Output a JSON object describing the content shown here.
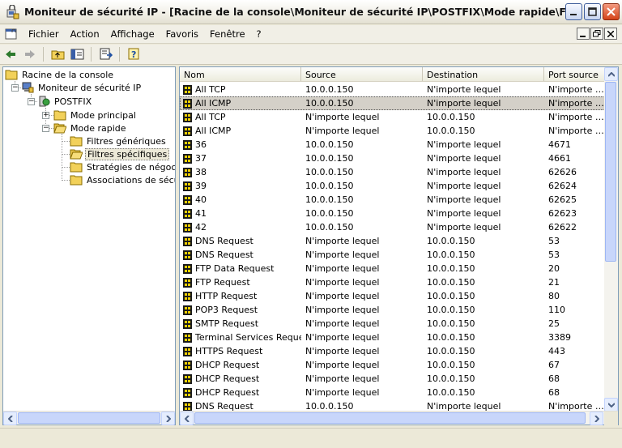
{
  "window": {
    "title": "Moniteur de sécurité IP - [Racine de la console\\Moniteur de sécurité IP\\POSTFIX\\Mode rapide\\Filtres spé..."
  },
  "menu": {
    "items": [
      {
        "label": "Fichier"
      },
      {
        "label": "Action"
      },
      {
        "label": "Affichage"
      },
      {
        "label": "Favoris"
      },
      {
        "label": "Fenêtre"
      },
      {
        "label": "?"
      }
    ]
  },
  "tree": {
    "nodes": [
      {
        "label": "Racine de la console",
        "icon": "folder-icon"
      },
      {
        "label": "Moniteur de sécurité IP",
        "icon": "computer-network-icon"
      },
      {
        "label": "POSTFIX",
        "icon": "server-icon"
      },
      {
        "label": "Mode principal",
        "icon": "folder-icon"
      },
      {
        "label": "Mode rapide",
        "icon": "folder-open-icon"
      },
      {
        "label": "Filtres génériques",
        "icon": "folder-icon"
      },
      {
        "label": "Filtres spécifiques",
        "icon": "folder-open-icon"
      },
      {
        "label": "Stratégies de négociatio",
        "icon": "folder-icon"
      },
      {
        "label": "Associations de sécurité",
        "icon": "folder-icon"
      }
    ]
  },
  "list": {
    "columns": [
      "Nom",
      "Source",
      "Destination",
      "Port source"
    ],
    "rows": [
      [
        "All TCP",
        "10.0.0.150",
        "N'importe lequel",
        "N'importe le..."
      ],
      [
        "All ICMP",
        "10.0.0.150",
        "N'importe lequel",
        "N'importe le..."
      ],
      [
        "All TCP",
        "N'importe lequel",
        "10.0.0.150",
        "N'importe le..."
      ],
      [
        "All ICMP",
        "N'importe lequel",
        "10.0.0.150",
        "N'importe le..."
      ],
      [
        "36",
        "10.0.0.150",
        "N'importe lequel",
        "4671"
      ],
      [
        "37",
        "10.0.0.150",
        "N'importe lequel",
        "4661"
      ],
      [
        "38",
        "10.0.0.150",
        "N'importe lequel",
        "62626"
      ],
      [
        "39",
        "10.0.0.150",
        "N'importe lequel",
        "62624"
      ],
      [
        "40",
        "10.0.0.150",
        "N'importe lequel",
        "62625"
      ],
      [
        "41",
        "10.0.0.150",
        "N'importe lequel",
        "62623"
      ],
      [
        "42",
        "10.0.0.150",
        "N'importe lequel",
        "62622"
      ],
      [
        "DNS Request",
        "N'importe lequel",
        "10.0.0.150",
        "53"
      ],
      [
        "DNS Request",
        "N'importe lequel",
        "10.0.0.150",
        "53"
      ],
      [
        "FTP Data Request",
        "N'importe lequel",
        "10.0.0.150",
        "20"
      ],
      [
        "FTP Request",
        "N'importe lequel",
        "10.0.0.150",
        "21"
      ],
      [
        "HTTP Request",
        "N'importe lequel",
        "10.0.0.150",
        "80"
      ],
      [
        "POP3 Request",
        "N'importe lequel",
        "10.0.0.150",
        "110"
      ],
      [
        "SMTP Request",
        "N'importe lequel",
        "10.0.0.150",
        "25"
      ],
      [
        "Terminal Services Request",
        "N'importe lequel",
        "10.0.0.150",
        "3389"
      ],
      [
        "HTTPS Request",
        "N'importe lequel",
        "10.0.0.150",
        "443"
      ],
      [
        "DHCP Request",
        "N'importe lequel",
        "10.0.0.150",
        "67"
      ],
      [
        "DHCP Request",
        "N'importe lequel",
        "10.0.0.150",
        "68"
      ],
      [
        "DHCP Request",
        "N'importe lequel",
        "10.0.0.150",
        "68"
      ],
      [
        "DNS Request",
        "10.0.0.150",
        "N'importe lequel",
        "N'importe le..."
      ]
    ],
    "selected_row": "All ICMP"
  },
  "colors": {
    "titlebar": "#f1efe6",
    "close": "#d4441a",
    "selection": "#d4d0c8",
    "pane_border": "#7f9db9"
  }
}
